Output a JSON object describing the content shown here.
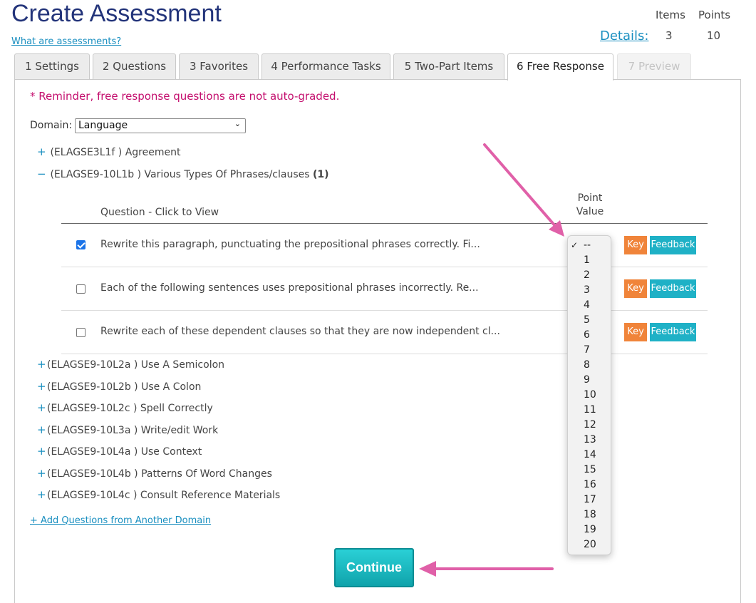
{
  "header": {
    "title": "Create Assessment",
    "help_link": "What are assessments?",
    "details_link": "Details:",
    "stats": {
      "items_label": "Items",
      "points_label": "Points",
      "items_value": "3",
      "points_value": "10"
    }
  },
  "tabs": [
    {
      "label": "1 Settings",
      "state": "normal"
    },
    {
      "label": "2 Questions",
      "state": "normal"
    },
    {
      "label": "3 Favorites",
      "state": "normal"
    },
    {
      "label": "4 Performance Tasks",
      "state": "normal"
    },
    {
      "label": "5 Two-Part Items",
      "state": "normal"
    },
    {
      "label": "6 Free Response",
      "state": "active"
    },
    {
      "label": "7 Preview",
      "state": "disabled"
    }
  ],
  "panel": {
    "reminder": "* Reminder, free response questions are not auto-graded.",
    "domain_label": "Domain:",
    "domain_selected": "Language",
    "standards_top": [
      {
        "sign": "+",
        "code": "(ELAGSE3L1f )",
        "name": "Agreement",
        "count": ""
      },
      {
        "sign": "−",
        "code": "(ELAGSE9-10L1b )",
        "name": "Various Types Of Phrases/clauses",
        "count": "(1)"
      }
    ],
    "table": {
      "col_question": "Question - Click to View",
      "col_point": "Point Value",
      "rows": [
        {
          "checked": true,
          "text": "Rewrite this paragraph, punctuating the prepositional phrases correctly. Fi...",
          "key": "Key",
          "feedback": "Feedback"
        },
        {
          "checked": false,
          "text": "Each of the following sentences uses prepositional phrases incorrectly. Re...",
          "key": "Key",
          "feedback": "Feedback"
        },
        {
          "checked": false,
          "text": "Rewrite each of these dependent clauses so that they are now independent cl...",
          "key": "Key",
          "feedback": "Feedback"
        }
      ]
    },
    "standards_bottom": [
      {
        "sign": "+",
        "code": "(ELAGSE9-10L2a )",
        "name": "Use A Semicolon"
      },
      {
        "sign": "+",
        "code": "(ELAGSE9-10L2b )",
        "name": "Use A Colon"
      },
      {
        "sign": "+",
        "code": "(ELAGSE9-10L2c )",
        "name": "Spell Correctly"
      },
      {
        "sign": "+",
        "code": "(ELAGSE9-10L3a )",
        "name": "Write/edit Work"
      },
      {
        "sign": "+",
        "code": "(ELAGSE9-10L4a )",
        "name": "Use Context"
      },
      {
        "sign": "+",
        "code": "(ELAGSE9-10L4b )",
        "name": "Patterns Of Word Changes"
      },
      {
        "sign": "+",
        "code": "(ELAGSE9-10L4c )",
        "name": "Consult Reference Materials"
      }
    ],
    "add_domain_link": "+ Add Questions from Another Domain",
    "continue_label": "Continue"
  },
  "point_dropdown": {
    "selected": "--",
    "check_mark": "✓",
    "options": [
      "--",
      "1",
      "2",
      "3",
      "4",
      "5",
      "6",
      "7",
      "8",
      "9",
      "10",
      "11",
      "12",
      "13",
      "14",
      "15",
      "16",
      "17",
      "18",
      "19",
      "20"
    ]
  },
  "annotation_color": "#e060a8"
}
